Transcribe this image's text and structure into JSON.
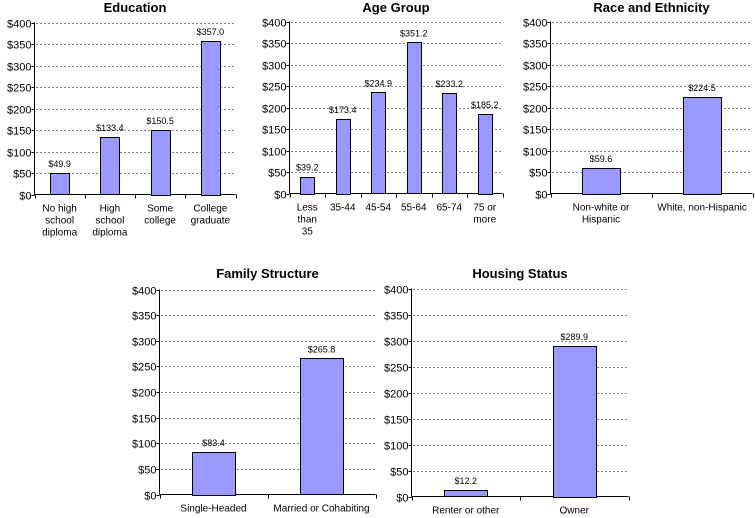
{
  "chart_data": [
    {
      "type": "bar",
      "title": "Education",
      "categories": [
        [
          "No high",
          "school",
          "diploma"
        ],
        [
          "High",
          "school",
          "diploma"
        ],
        [
          "Some",
          "college"
        ],
        [
          "College",
          "graduate"
        ]
      ],
      "values": [
        49.9,
        133.4,
        150.5,
        357.0
      ],
      "data_labels": [
        "$49.9",
        "$133.4",
        "$150.5",
        "$357.0"
      ],
      "xlabel": "",
      "ylabel": "",
      "ylim": [
        0,
        400
      ],
      "yticks": [
        "$0",
        "$50",
        "$100",
        "$150",
        "$200",
        "$250",
        "$300",
        "$350",
        "$400"
      ],
      "grid": true,
      "bar_color": "#9999ff"
    },
    {
      "type": "bar",
      "title": "Age Group",
      "categories": [
        [
          "Less",
          "than",
          "35"
        ],
        [
          "35-44"
        ],
        [
          "45-54"
        ],
        [
          "55-64"
        ],
        [
          "65-74"
        ],
        [
          "75 or",
          "more"
        ]
      ],
      "values": [
        39.2,
        173.4,
        234.9,
        351.2,
        233.2,
        185.2
      ],
      "data_labels": [
        "$39.2",
        "$173.4",
        "$234.9",
        "$351.2",
        "$233.2",
        "$185.2"
      ],
      "xlabel": "",
      "ylabel": "",
      "ylim": [
        0,
        400
      ],
      "yticks": [
        "$0",
        "$50",
        "$100",
        "$150",
        "$200",
        "$250",
        "$300",
        "$350",
        "$400"
      ],
      "grid": true,
      "bar_color": "#9999ff"
    },
    {
      "type": "bar",
      "title": "Race and Ethnicity",
      "categories": [
        [
          "Non-white or",
          "Hispanic"
        ],
        [
          "White, non-Hispanic"
        ]
      ],
      "values": [
        59.6,
        224.5
      ],
      "data_labels": [
        "$59.6",
        "$224.5"
      ],
      "xlabel": "",
      "ylabel": "",
      "ylim": [
        0,
        400
      ],
      "yticks": [
        "$0",
        "$50",
        "$100",
        "$150",
        "$200",
        "$250",
        "$300",
        "$350",
        "$400"
      ],
      "grid": true,
      "bar_color": "#9999ff"
    },
    {
      "type": "bar",
      "title": "Family Structure",
      "categories": [
        [
          "Single-Headed"
        ],
        [
          "Married or Cohabiting"
        ]
      ],
      "values": [
        83.4,
        265.8
      ],
      "data_labels": [
        "$83.4",
        "$265.8"
      ],
      "xlabel": "",
      "ylabel": "",
      "ylim": [
        0,
        400
      ],
      "yticks": [
        "$0",
        "$50",
        "$100",
        "$150",
        "$200",
        "$250",
        "$300",
        "$350",
        "$400"
      ],
      "grid": true,
      "bar_color": "#9999ff"
    },
    {
      "type": "bar",
      "title": "Housing Status",
      "categories": [
        [
          "Renter or other"
        ],
        [
          "Owner"
        ]
      ],
      "values": [
        12.2,
        289.9
      ],
      "data_labels": [
        "$12.2",
        "$289.9"
      ],
      "xlabel": "",
      "ylabel": "",
      "ylim": [
        0,
        400
      ],
      "yticks": [
        "$0",
        "$50",
        "$100",
        "$150",
        "$200",
        "$250",
        "$300",
        "$350",
        "$400"
      ],
      "grid": true,
      "bar_color": "#9999ff"
    }
  ]
}
